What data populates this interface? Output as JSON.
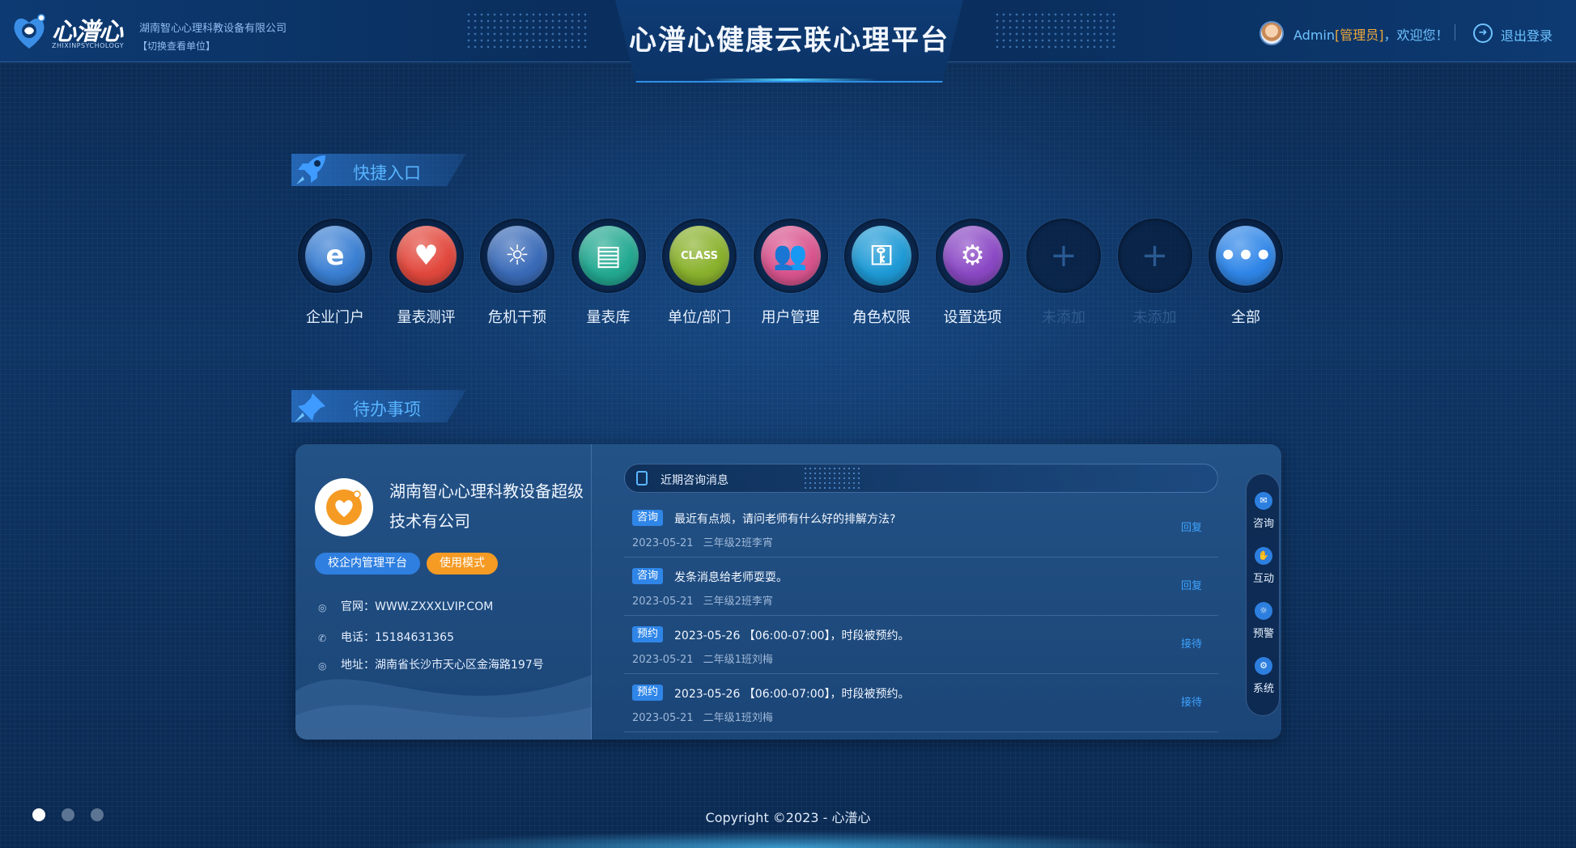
{
  "header": {
    "title": "心潽心健康云联心理平台",
    "logo_text": "心潽心",
    "logo_sub": "ZHIXINPSYCHOLOGY",
    "company": "湖南智心心理科教设备有限公司",
    "switch_unit": "【切换查看单位】",
    "user": "Admin",
    "role": "[管理员]",
    "welcome_suffix": "，欢迎您！",
    "logout": "退出登录"
  },
  "quick_section": {
    "title": "快捷入口",
    "items": [
      {
        "label": "企业门户",
        "icon": "ie-browser-icon",
        "glyph": "e",
        "color": "#3a7fd3"
      },
      {
        "label": "量表测评",
        "icon": "heart-icon",
        "glyph": "♥",
        "color": "#e2483d"
      },
      {
        "label": "危机干预",
        "icon": "alarm-light-icon",
        "glyph": "☼",
        "color": "#3a6bb8"
      },
      {
        "label": "量表库",
        "icon": "document-icon",
        "glyph": "▤",
        "color": "#23a991"
      },
      {
        "label": "单位/部门",
        "icon": "class-sign-icon",
        "glyph": "CLASS",
        "color": "#8ab22d"
      },
      {
        "label": "用户管理",
        "icon": "users-icon",
        "glyph": "👥",
        "color": "#d9548e"
      },
      {
        "label": "角色权限",
        "icon": "key-icon",
        "glyph": "⚿",
        "color": "#1e9ad6"
      },
      {
        "label": "设置选项",
        "icon": "gear-icon",
        "glyph": "⚙",
        "color": "#8b49c5"
      },
      {
        "label": "未添加",
        "icon": "plus-icon",
        "glyph": "+",
        "color": "",
        "empty": true
      },
      {
        "label": "未添加",
        "icon": "plus-icon",
        "glyph": "+",
        "color": "",
        "empty": true
      },
      {
        "label": "全部",
        "icon": "more-icon",
        "glyph": "•••",
        "color": "#2f86e8"
      }
    ]
  },
  "todo_section": {
    "title": "待办事项",
    "company": {
      "name": "湖南智心心理科教设备超级技术有公司",
      "tag_platform": "校企内管理平台",
      "tag_mode": "使用模式",
      "website": "官网：WWW.ZXXXLVIP.COM",
      "phone": "电话：15184631365",
      "address": "地址：湖南省长沙市天心区金海路197号"
    },
    "messages_title": "近期咨询消息",
    "messages": [
      {
        "badge": "咨询",
        "text": "最近有点烦，请问老师有什么好的排解方法?",
        "date": "2023-05-21",
        "who": "三年级2班李宵",
        "action": "回复"
      },
      {
        "badge": "咨询",
        "text": "发条消息给老师耍耍。",
        "date": "2023-05-21",
        "who": "三年级2班李宵",
        "action": "回复"
      },
      {
        "badge": "预约",
        "text": "2023-05-26 【06:00-07:00】，时段被预约。",
        "date": "2023-05-21",
        "who": "二年级1班刘梅",
        "action": "接待"
      },
      {
        "badge": "预约",
        "text": "2023-05-26 【06:00-07:00】，时段被预约。",
        "date": "2023-05-21",
        "who": "二年级1班刘梅",
        "action": "接待"
      }
    ],
    "rail": [
      {
        "label": "咨询",
        "icon": "chat-icon"
      },
      {
        "label": "互动",
        "icon": "handshake-icon"
      },
      {
        "label": "预警",
        "icon": "alarm-icon"
      },
      {
        "label": "系统",
        "icon": "gear-icon"
      }
    ]
  },
  "footer": {
    "copyright": "Copyright ©2023 - 心潽心",
    "pager": [
      {
        "active": true
      },
      {
        "active": false
      },
      {
        "active": false
      }
    ]
  },
  "colors": {
    "accent": "#3ea3ff",
    "warning": "#f59a23"
  }
}
